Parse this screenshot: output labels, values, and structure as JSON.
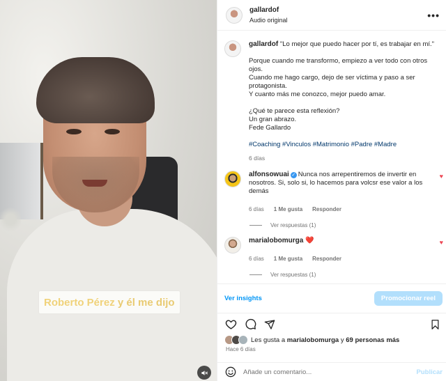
{
  "video": {
    "caption_part1": "Roberto Pérez",
    "caption_part2": " y él me dijo",
    "mute_icon": "muted-speaker-icon"
  },
  "header": {
    "username": "gallardof",
    "audio": "Audio original",
    "more_icon": "more-options-icon",
    "more_label": "•••"
  },
  "post": {
    "username": "gallardof",
    "first_line": "\"Lo mejor que puedo hacer por tí, es trabajar en mí.\"",
    "para1": "Porque cuando me transformo, empiezo a ver todo con otros ojos.",
    "para2": "Cuando me hago cargo, dejo de ser víctima y paso a ser protagonista.",
    "para3": "Y cuanto más me conozco, mejor puedo amar.",
    "q1": "¿Qué te parece esta reflexión?",
    "q2": "Un gran abrazo.",
    "q3": "Fede Gallardo",
    "hashtags": "#Coaching #Vinculos #Matrimonio #Padre #Madre",
    "time": "6 días"
  },
  "comments": [
    {
      "username": "alfonsowuai",
      "text": "Nunca nos arrepentiremos de invertir en nosotros. Si, solo si, lo hacemos para volcsr ese valor a los demás",
      "time": "6 días",
      "likes": "1 Me gusta",
      "reply": "Responder",
      "view_replies": "Ver respuestas (1)"
    },
    {
      "username": "marialobomurga",
      "text": "❤️",
      "time": "6 días",
      "likes": "1 Me gusta",
      "reply": "Responder",
      "view_replies": "Ver respuestas (1)"
    }
  ],
  "insights": {
    "view_label": "Ver insights",
    "promote_label": "Promocionar reel"
  },
  "likes": {
    "prefix": "Les gusta a ",
    "user": "marialobomurga",
    "middle": " y ",
    "count": "69 personas más",
    "time": "Hace 6 días"
  },
  "add_comment": {
    "placeholder": "Añade un comentario...",
    "publish": "Publicar"
  },
  "colors": {
    "link_blue": "#0095f6",
    "hashtag_blue": "#00376b",
    "promote_bg": "#b2dffc",
    "caption_yellow": "#f0d27a",
    "like_red": "#ed4956"
  }
}
